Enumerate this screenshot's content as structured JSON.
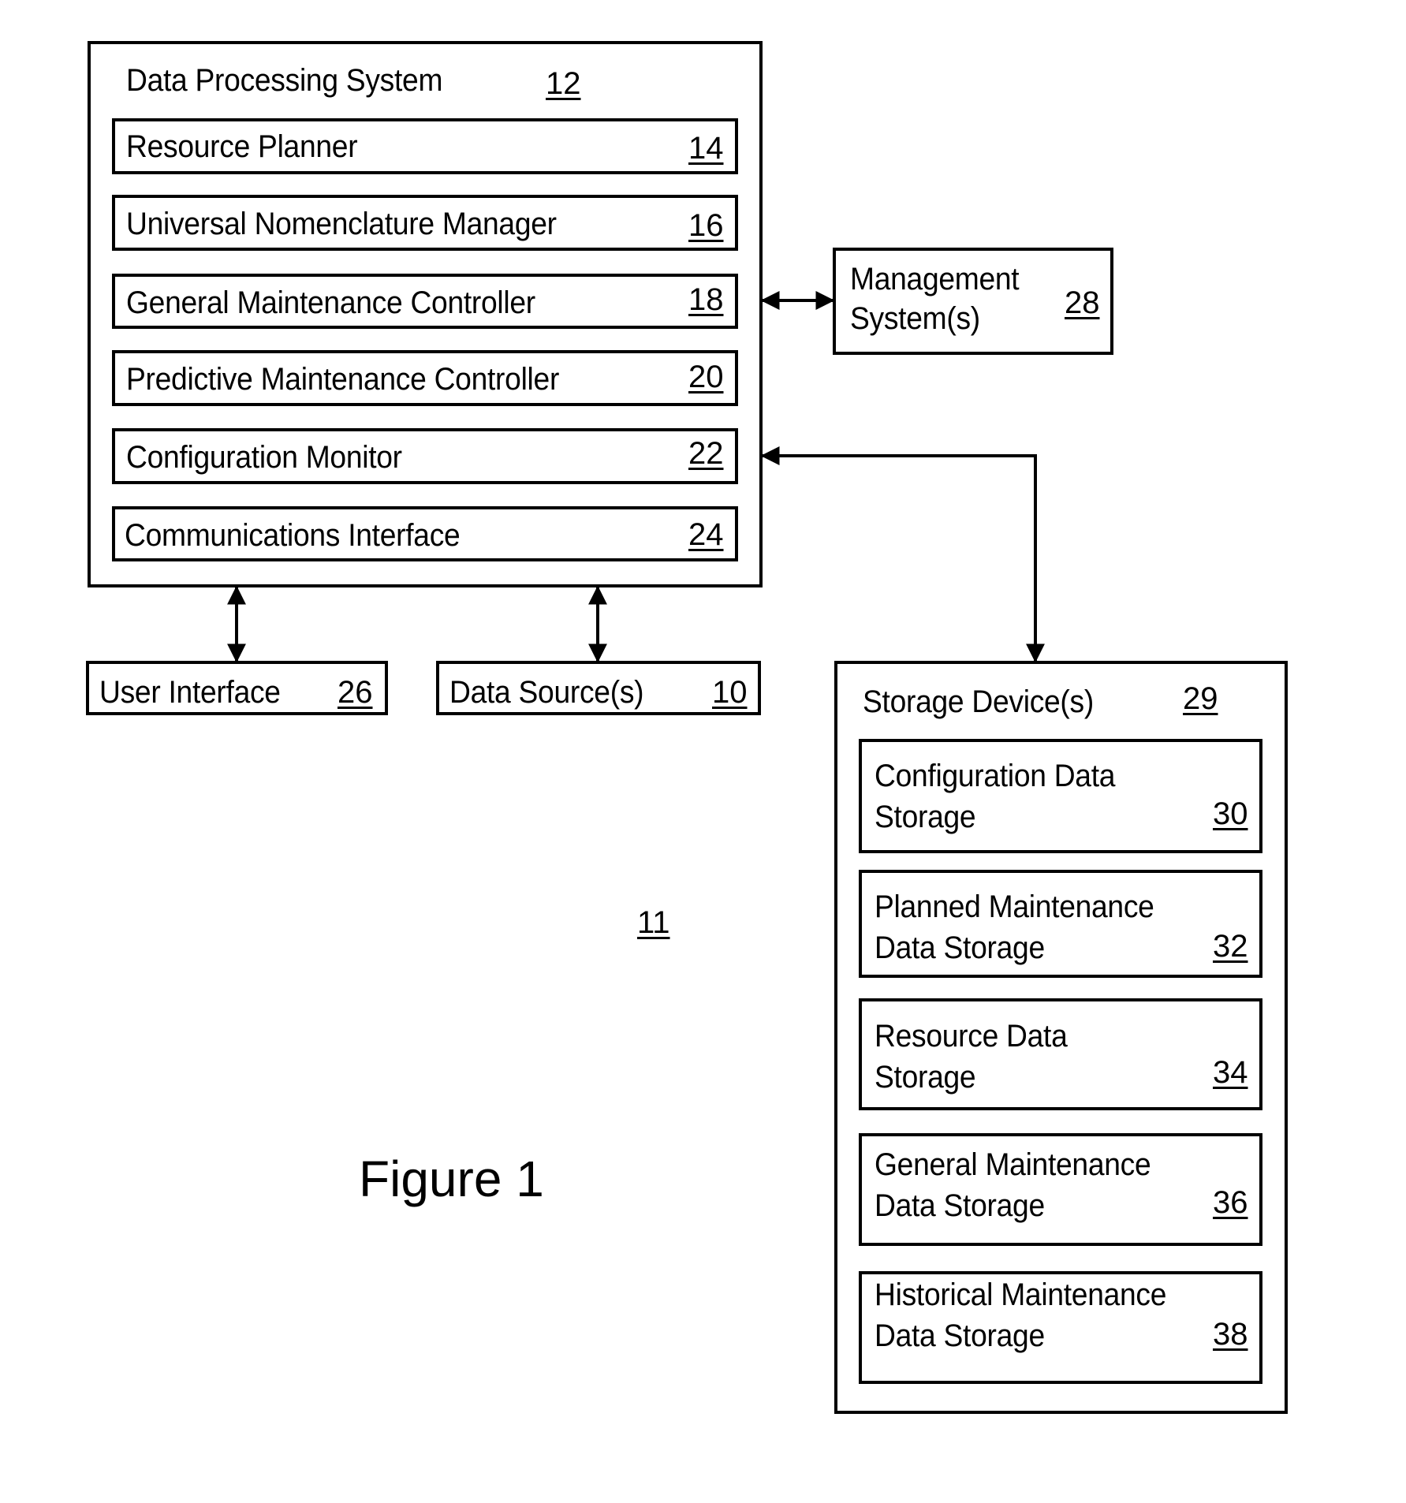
{
  "figure": {
    "caption": "Figure 1",
    "system_ref": "11"
  },
  "data_processing_system": {
    "title": "Data Processing System",
    "ref": "12",
    "components": [
      {
        "label": "Resource Planner",
        "ref": "14"
      },
      {
        "label": "Universal Nomenclature Manager",
        "ref": "16"
      },
      {
        "label": "General Maintenance Controller",
        "ref": "18"
      },
      {
        "label": "Predictive Maintenance Controller",
        "ref": "20"
      },
      {
        "label": "Configuration Monitor",
        "ref": "22"
      },
      {
        "label": "Communications Interface",
        "ref": "24"
      }
    ]
  },
  "management_system": {
    "line1": "Management",
    "line2": "System(s)",
    "ref": "28"
  },
  "user_interface": {
    "label": "User Interface",
    "ref": "26"
  },
  "data_sources": {
    "label": "Data Source(s)",
    "ref": "10"
  },
  "storage_devices": {
    "title": "Storage Device(s)",
    "ref": "29",
    "items": [
      {
        "line1": "Configuration Data",
        "line2": "Storage",
        "ref": "30"
      },
      {
        "line1": "Planned Maintenance",
        "line2": "Data Storage",
        "ref": "32"
      },
      {
        "line1": "Resource Data",
        "line2": "Storage",
        "ref": "34"
      },
      {
        "line1": "General Maintenance",
        "line2": "Data Storage",
        "ref": "36"
      },
      {
        "line1": "Historical Maintenance",
        "line2": "Data Storage",
        "ref": "38"
      }
    ]
  },
  "connections": [
    {
      "from": "data_processing_system",
      "to": "management_system",
      "type": "bidirectional"
    },
    {
      "from": "data_processing_system",
      "to": "storage_devices",
      "type": "bidirectional"
    },
    {
      "from": "data_processing_system",
      "to": "user_interface",
      "type": "bidirectional"
    },
    {
      "from": "data_processing_system",
      "to": "data_sources",
      "type": "bidirectional"
    }
  ]
}
